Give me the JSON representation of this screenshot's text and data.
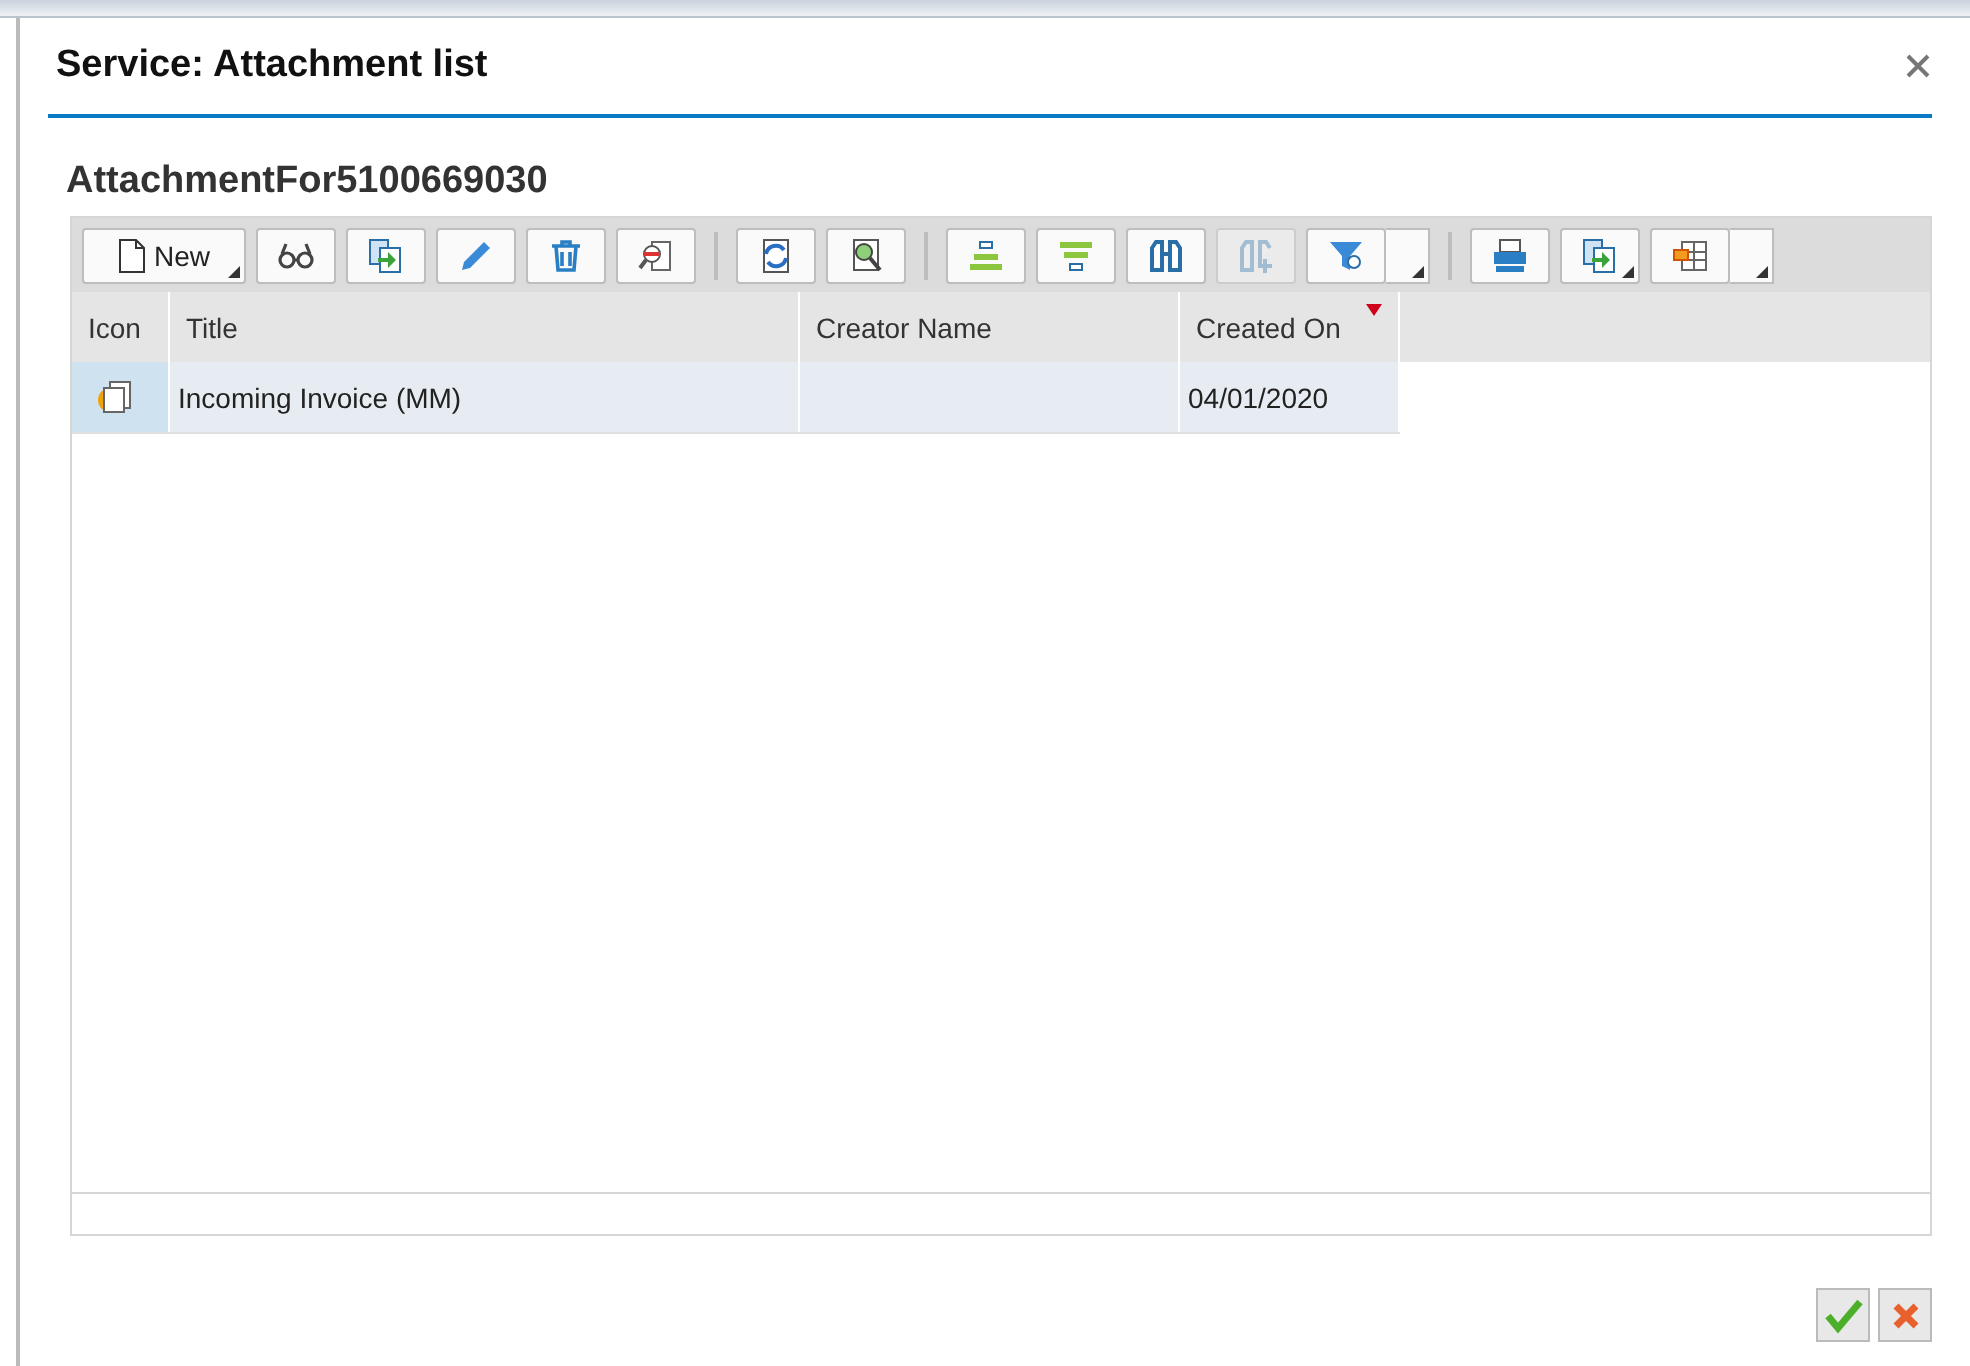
{
  "dialog": {
    "title": "Service: Attachment list",
    "heading": "AttachmentFor5100669030"
  },
  "toolbar": [
    {
      "kind": "menu-button",
      "label": "New",
      "disabled": false
    },
    {
      "kind": "button",
      "disabled": false
    },
    {
      "kind": "button",
      "disabled": false
    },
    {
      "kind": "button",
      "disabled": false
    },
    {
      "kind": "button",
      "disabled": false
    },
    {
      "kind": "button",
      "disabled": false
    },
    {
      "kind": "separator"
    },
    {
      "kind": "button",
      "disabled": false
    },
    {
      "kind": "button",
      "disabled": false
    },
    {
      "kind": "separator"
    },
    {
      "kind": "button",
      "disabled": false
    },
    {
      "kind": "button",
      "disabled": false
    },
    {
      "kind": "button",
      "disabled": false
    },
    {
      "kind": "button",
      "disabled": true
    },
    {
      "kind": "split-button",
      "disabled": false
    },
    {
      "kind": "separator"
    },
    {
      "kind": "button",
      "disabled": false
    },
    {
      "kind": "menu-button",
      "disabled": false
    },
    {
      "kind": "split-button",
      "disabled": false
    }
  ],
  "table": {
    "columns": [
      {
        "label": "Icon",
        "sorted": false
      },
      {
        "label": "Title",
        "sorted": false
      },
      {
        "label": "Creator Name",
        "sorted": false
      },
      {
        "label": "Created On",
        "sorted": true
      }
    ],
    "rows": [
      {
        "selected": true,
        "title": "Incoming Invoice (MM)",
        "created_on": "04/01/2020"
      }
    ]
  },
  "footer_buttons": [
    {
      "kind": "confirm"
    },
    {
      "kind": "cancel"
    }
  ]
}
